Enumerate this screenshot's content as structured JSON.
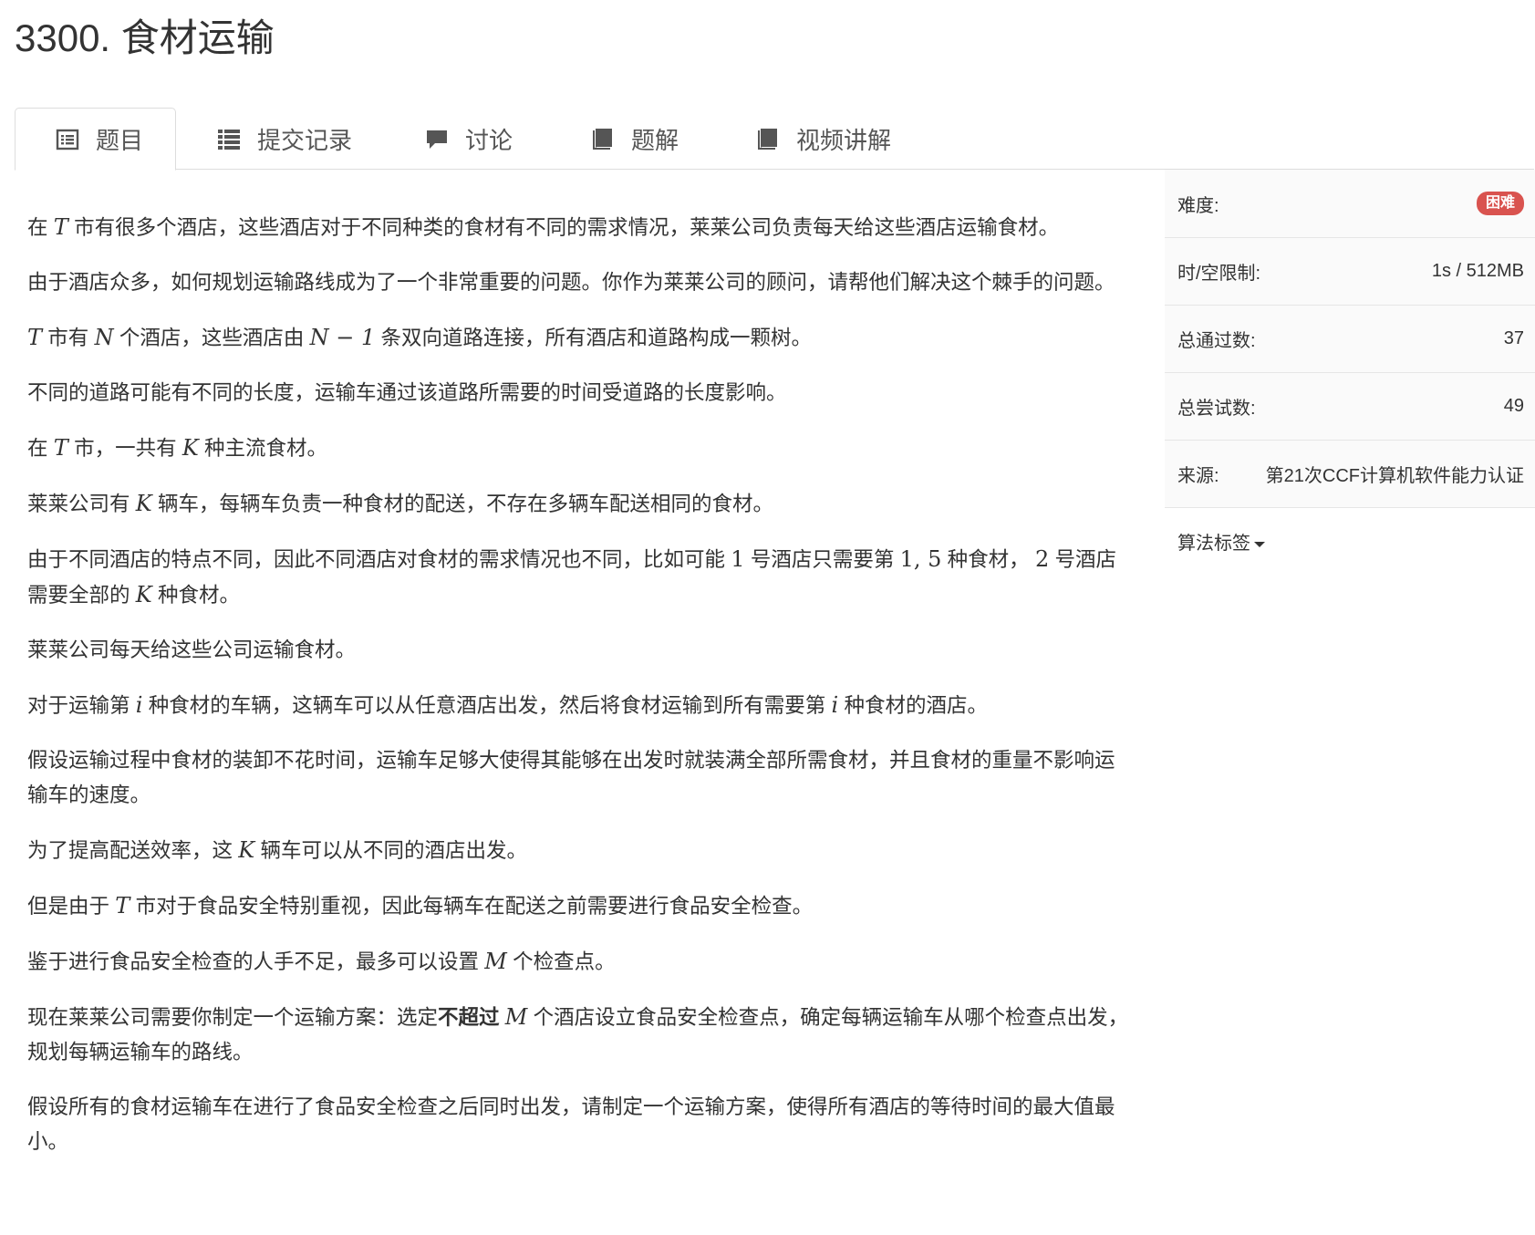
{
  "problem": {
    "title": "3300. 食材运输"
  },
  "tabs": [
    {
      "label": "题目",
      "icon": "list-alt-icon",
      "active": true
    },
    {
      "label": "提交记录",
      "icon": "list-icon"
    },
    {
      "label": "讨论",
      "icon": "comment-icon"
    },
    {
      "label": "题解",
      "icon": "book-icon"
    },
    {
      "label": "视频讲解",
      "icon": "book-icon"
    }
  ],
  "content": {
    "p1": {
      "a": "在",
      "T": "T",
      "b": "市有很多个酒店，这些酒店对于不同种类的食材有不同的需求情况，莱莱公司负责每天给这些酒店运输食材。"
    },
    "p2": "由于酒店众多，如何规划运输路线成为了一个非常重要的问题。你作为莱莱公司的顾问，请帮他们解决这个棘手的问题。",
    "p3": {
      "T": "T",
      "a": "市有",
      "N": "N",
      "b": "个酒店，这些酒店由",
      "N1": "N − 1",
      "c": "条双向道路连接，所有酒店和道路构成一颗树。"
    },
    "p4": "不同的道路可能有不同的长度，运输车通过该道路所需要的时间受道路的长度影响。",
    "p5": {
      "a": "在",
      "T": "T",
      "b": "市，一共有",
      "K": "K",
      "c": "种主流食材。"
    },
    "p6": {
      "a": "莱莱公司有",
      "K": "K",
      "b": "辆车，每辆车负责一种食材的配送，不存在多辆车配送相同的食材。"
    },
    "p7": {
      "a": "由于不同酒店的特点不同，因此不同酒店对食材的需求情况也不同，比如可能",
      "n1": "1",
      "b": "号酒店只需要第",
      "n15": "1, 5",
      "c": "种食材，",
      "n2": "2",
      "d": "号酒店需要全部的",
      "K": "K",
      "e": "种食材。"
    },
    "p8": "莱莱公司每天给这些公司运输食材。",
    "p9": {
      "a": "对于运输第",
      "i1": "i",
      "b": "种食材的车辆，这辆车可以从任意酒店出发，然后将食材运输到所有需要第",
      "i2": "i",
      "c": "种食材的酒店。"
    },
    "p10": "假设运输过程中食材的装卸不花时间，运输车足够大使得其能够在出发时就装满全部所需食材，并且食材的重量不影响运输车的速度。",
    "p11": {
      "a": "为了提高配送效率，这",
      "K": "K",
      "b": "辆车可以从不同的酒店出发。"
    },
    "p12": {
      "a": "但是由于",
      "T": "T",
      "b": "市对于食品安全特别重视，因此每辆车在配送之前需要进行食品安全检查。"
    },
    "p13": {
      "a": "鉴于进行食品安全检查的人手不足，最多可以设置",
      "M": "M",
      "b": "个检查点。"
    },
    "p14": {
      "a": "现在莱莱公司需要你制定一个运输方案：选定",
      "bold": "不超过",
      "M": "M",
      "b": "个酒店设立食品安全检查点，确定每辆运输车从哪个检查点出发，规划每辆运输车的路线。"
    },
    "p15": "假设所有的食材运输车在进行了食品安全检查之后同时出发，请制定一个运输方案，使得所有酒店的等待时间的最大值最小。"
  },
  "sidebar": {
    "difficulty_label": "难度:",
    "difficulty_value": "困难",
    "difficulty_color": "#d9534f",
    "limit_label": "时/空限制:",
    "limit_value": "1s / 512MB",
    "passed_label": "总通过数:",
    "passed_value": "37",
    "tried_label": "总尝试数:",
    "tried_value": "49",
    "source_label": "来源:",
    "source_value": "第21次CCF计算机软件能力认证",
    "tags_label": "算法标签"
  }
}
